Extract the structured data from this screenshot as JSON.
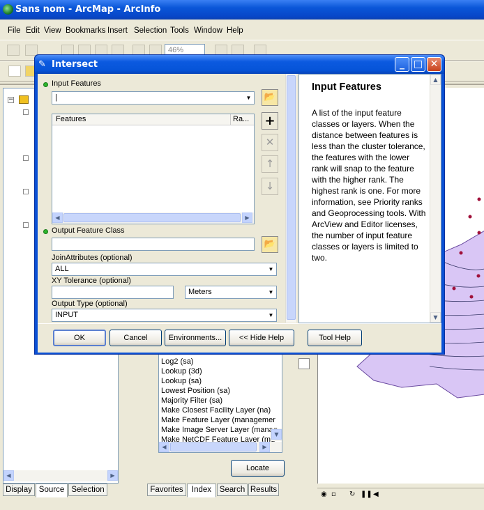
{
  "app": {
    "title": "Sans nom - ArcMap - ArcInfo",
    "menu": [
      "File",
      "Edit",
      "View",
      "Bookmarks",
      "Insert",
      "Selection",
      "Tools",
      "Window",
      "Help"
    ],
    "zoom": "46%"
  },
  "toc_tabs": [
    "Display",
    "Source",
    "Selection"
  ],
  "search": {
    "items": [
      "Log2 (sa)",
      "Lookup (3d)",
      "Lookup (sa)",
      "Lowest Position (sa)",
      "Majority Filter (sa)",
      "Make Closest Facility Layer (na)",
      "Make Feature Layer (managemer",
      "Make Image Server Layer (manag",
      "Make NetCDF Feature Layer (md"
    ],
    "locate": "Locate",
    "tabs": [
      "Favorites",
      "Index",
      "Search",
      "Results"
    ]
  },
  "dialog": {
    "title": "Intersect",
    "input_features_label": "Input Features",
    "input_features_value": "|",
    "table_headers": [
      "Features",
      "Ra..."
    ],
    "output_label": "Output Feature Class",
    "output_value": "",
    "join_label": "JoinAttributes (optional)",
    "join_value": "ALL",
    "xy_label": "XY Tolerance (optional)",
    "xy_value": "",
    "xy_units": "Meters",
    "type_label": "Output Type (optional)",
    "type_value": "INPUT",
    "buttons": {
      "ok": "OK",
      "cancel": "Cancel",
      "environments": "Environments...",
      "hide_help": "<< Hide Help",
      "tool_help": "Tool Help"
    },
    "help_title": "Input Features",
    "help_text": "A list of the input feature classes or layers. When the distance between features is less than the cluster tolerance, the features with the lower rank will snap to the feature with the higher rank. The highest rank is one. For more information, see Priority ranks and Geoprocessing tools. With ArcView and Editor licenses, the number of input feature classes or layers is limited to two."
  },
  "colors": {
    "title_blue": "#0a56d8",
    "map_fill": "#d9c6f5",
    "map_point": "#a0103a"
  }
}
